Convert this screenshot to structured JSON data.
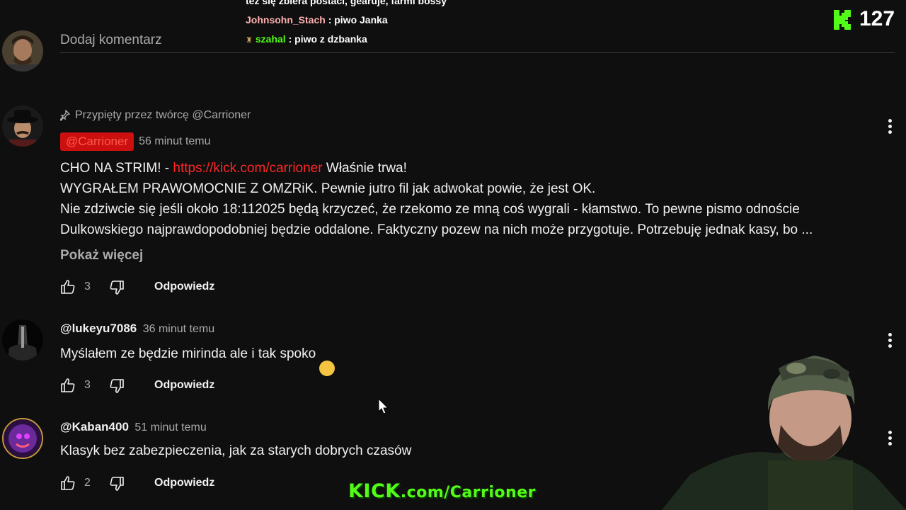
{
  "chat": {
    "top_line": "też się zbiera postaci, gearuje, farmi bossy",
    "line1_user": "Johnsohn_Stach",
    "line1_msg": ": piwo Janka",
    "line2_user": "szahal",
    "line2_msg": ": piwo z dzbanka"
  },
  "viewers": {
    "count": "127",
    "icon": "kick-logo-icon",
    "accent": "#53fc18"
  },
  "add_comment": {
    "placeholder": "Dodaj komentarz"
  },
  "comments": [
    {
      "pinned": "Przypięty przez twórcę @Carrioner",
      "author": "@Carrioner",
      "time": "56 minut temu",
      "lines": [
        "CHO NA STRIM! - ",
        "https://kick.com/carrioner",
        " Właśnie trwa!",
        "WYGRAŁEM PRAWOMOCNIE Z OMZRiK. Pewnie jutro fil jak adwokat powie, że jest OK.",
        "Nie zdziwcie się jeśli około 18:112025 będą krzyczeć, że rzekomo ze mną coś wygrali - kłamstwo. To pewne pismo odnoście",
        "Dulkowskiego najprawdopodobniej będzie oddalone. Faktyczny pozew na nich może przygotuje. Potrzebuję jednak kasy, bo ..."
      ],
      "show_more": "Pokaż więcej",
      "likes": "3",
      "reply": "Odpowiedz"
    },
    {
      "author": "@lukeyu7086",
      "time": "36 minut temu",
      "text": "Myślałem ze będzie mirinda ale i tak spoko",
      "emoji": "😉",
      "likes": "3",
      "reply": "Odpowiedz"
    },
    {
      "author": "@Kaban400",
      "time": "51 minut temu",
      "text": "Klasyk bez zabezpieczenia, jak za starych dobrych czasów",
      "likes": "2",
      "reply": "Odpowiedz"
    }
  ],
  "overlay": {
    "kick_brand": "KICK",
    "kick_url": ".com/Carrioner"
  },
  "colors": {
    "link": "#ff2525",
    "author_badge_bg": "#cc1010",
    "author_badge_text": "#ff5a4a",
    "chat_user1": "#ffb0b0",
    "chat_user2": "#53fc18"
  }
}
